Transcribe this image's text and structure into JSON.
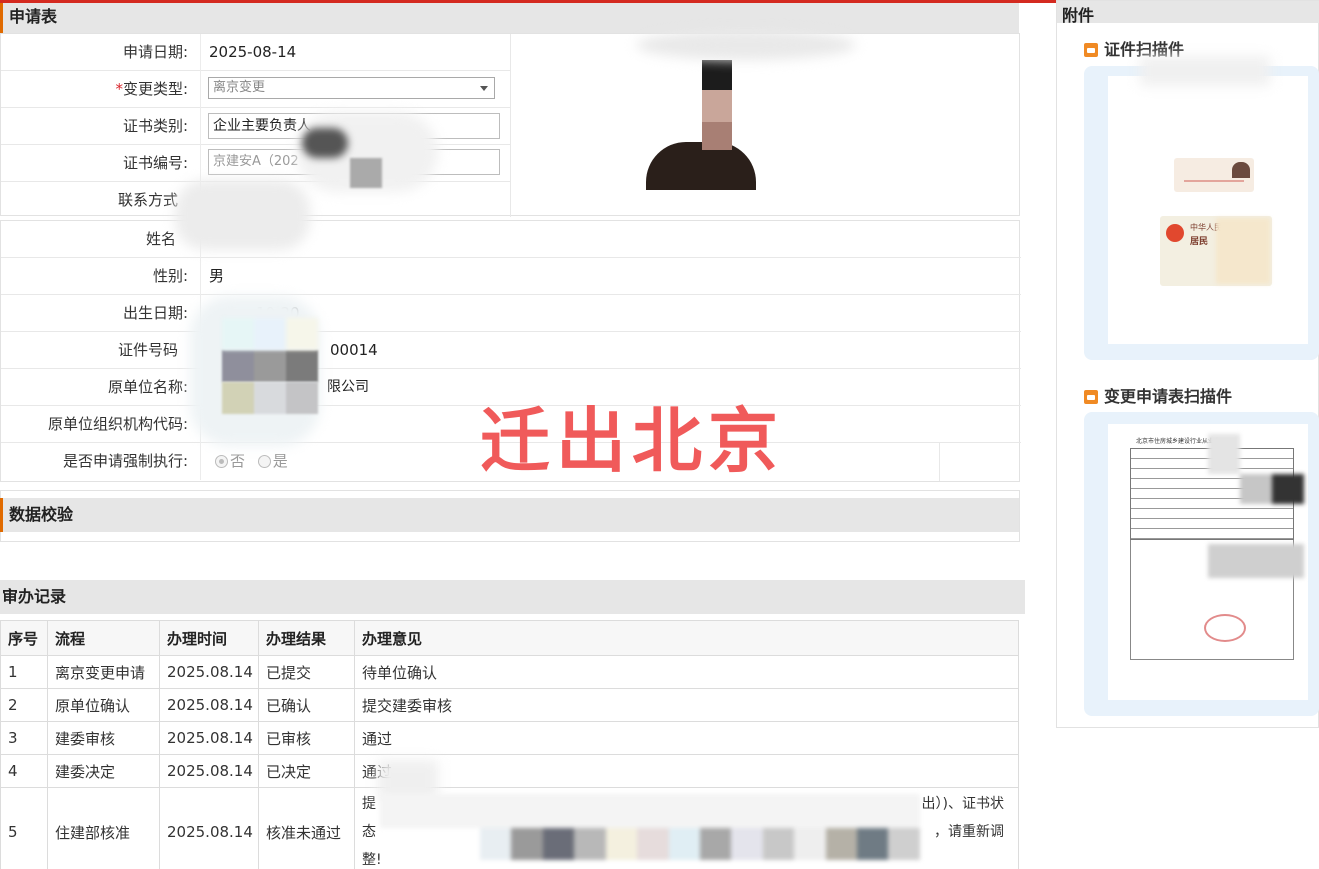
{
  "form": {
    "section_title": "申请表",
    "apply_date_label": "申请日期:",
    "apply_date_value": "2025-08-14",
    "change_type_required_mark": "*",
    "change_type_label": "变更类型:",
    "change_type_value": "离京变更",
    "cert_type_label": "证书类别:",
    "cert_type_value": "企业主要负责人",
    "cert_no_label": "证书编号:",
    "cert_no_value": "京建安A（202",
    "contact_label": "联系方式",
    "name_label": "姓名",
    "gender_label": "性别:",
    "gender_value": "男",
    "birth_label": "出生日期:",
    "birth_value": "10-20",
    "id_label": "证件号码",
    "id_value": "00014",
    "orig_unit_label": "原单位名称:",
    "orig_unit_value": "限公司",
    "orig_org_code_label": "原单位组织机构代码:",
    "force_exec_label": "是否申请强制执行:",
    "force_exec_no": "否",
    "force_exec_yes": "是"
  },
  "watermark": "迁出北京",
  "validation": {
    "section_title": "数据校验"
  },
  "records": {
    "section_title": "审办记录",
    "headers": [
      "序号",
      "流程",
      "办理时间",
      "办理结果",
      "办理意见"
    ],
    "rows": [
      [
        "1",
        "离京变更申请",
        "2025.08.14",
        "已提交",
        "待单位确认"
      ],
      [
        "2",
        "原单位确认",
        "2025.08.14",
        "已确认",
        "提交建委审核"
      ],
      [
        "3",
        "建委审核",
        "2025.08.14",
        "已审核",
        "通过"
      ],
      [
        "4",
        "建委决定",
        "2025.08.14",
        "已决定",
        "通过"
      ],
      [
        "5",
        "住建部核准",
        "2025.08.14",
        "核准未通过",
        ""
      ]
    ],
    "row5_opinion_line1_start": "提",
    "row5_opinion_line1_end": "出）)、证书状",
    "row5_opinion_line2_start": "态",
    "row5_opinion_line2_end": "，请重新调",
    "row5_opinion_line3": "整!"
  },
  "attachments": {
    "title": "附件",
    "items": [
      {
        "label": "证件扫描件",
        "icon": "image-icon"
      },
      {
        "label": "变更申请表扫描件",
        "icon": "image-icon"
      }
    ],
    "doc_heading": "北京市住房城乡建设行业从业人",
    "id_card_text1": "中华人民",
    "id_card_text2": "居民"
  },
  "colors": {
    "accent": "#e06a00",
    "top_bar": "#d42a20",
    "watermark": "#f05a5a",
    "header_bg": "#e6e6e6"
  }
}
